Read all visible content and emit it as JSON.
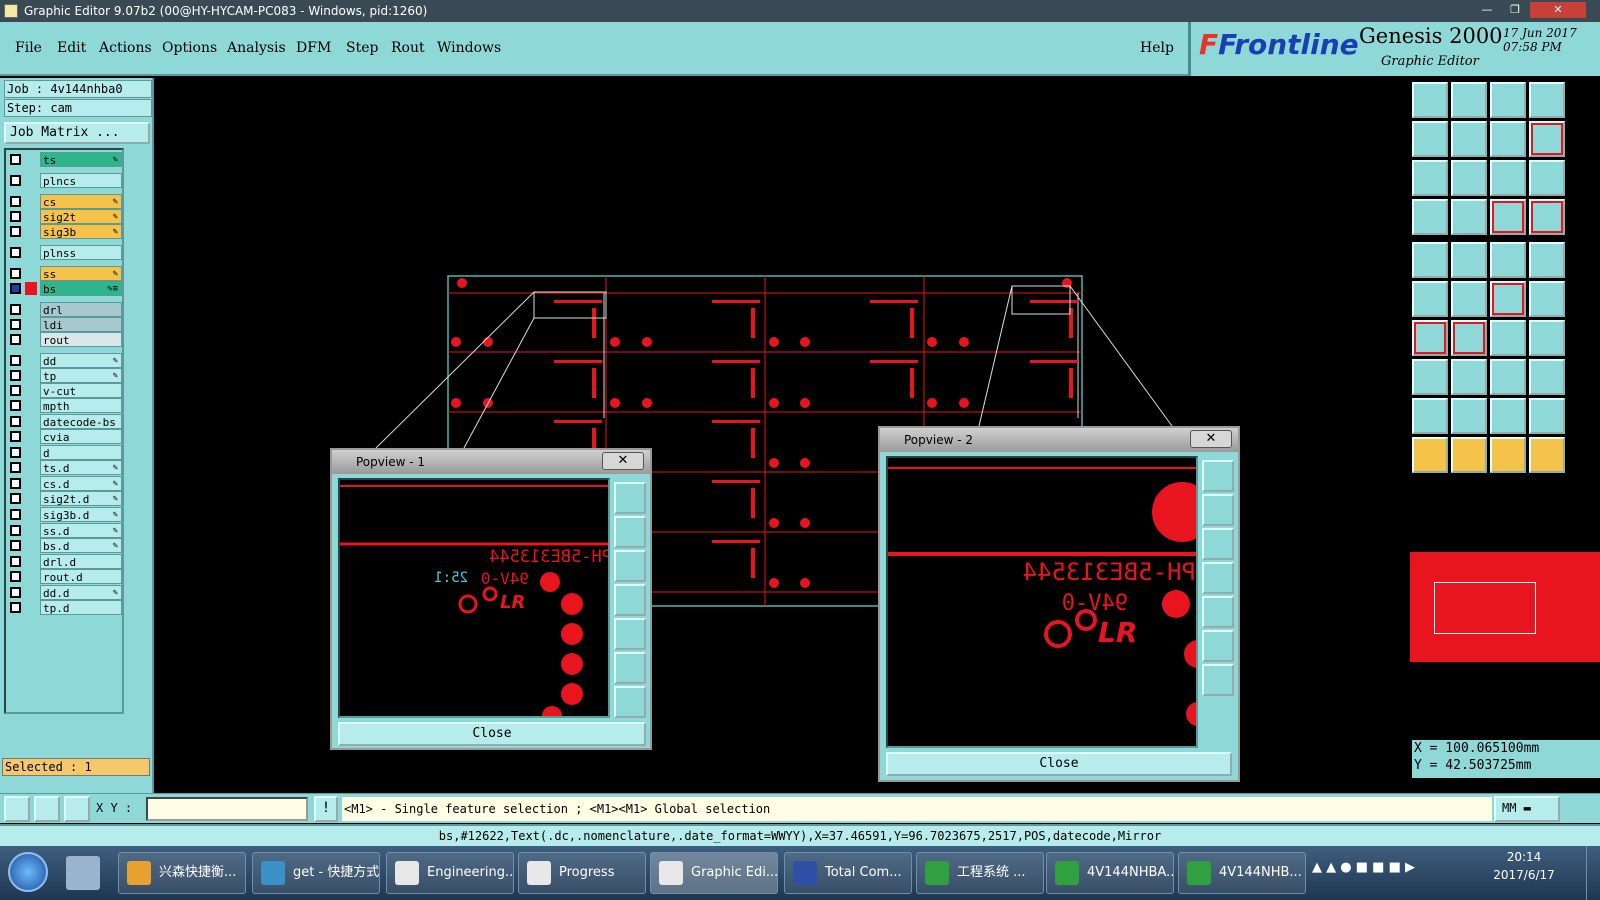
{
  "window": {
    "title": "Graphic Editor 9.07b2 (00@HY-HYCAM-PC083 - Windows, pid:1260)"
  },
  "menu": {
    "items": [
      "File",
      "Edit",
      "Actions",
      "Options",
      "Analysis",
      "DFM",
      "Step",
      "Rout",
      "Windows"
    ],
    "help": "Help"
  },
  "brand": {
    "logo_main": "Frontline",
    "logo_f": "F",
    "product": "Genesis 2000",
    "subtitle": "Graphic Editor",
    "date": "17 Jun 2017",
    "time": "07:58 PM"
  },
  "left": {
    "job": "Job : 4v144nhba0",
    "step": "Step: cam",
    "job_matrix": "Job Matrix ...",
    "selected": "Selected : 1",
    "layers": [
      {
        "name": "ts",
        "color": "#2fb58a",
        "flag": "✎"
      },
      {
        "name": "plncs",
        "color": "#b7ecec",
        "flag": ""
      },
      {
        "name": "cs",
        "color": "#f5c24a",
        "flag": "✎"
      },
      {
        "name": "sig2t",
        "color": "#f5c24a",
        "flag": "✎"
      },
      {
        "name": "sig3b",
        "color": "#f5c24a",
        "flag": "✎"
      },
      {
        "name": "plnss",
        "color": "#b7ecec",
        "flag": ""
      },
      {
        "name": "ss",
        "color": "#f5c24a",
        "flag": "✎"
      },
      {
        "name": "bs",
        "color": "#2fb58a",
        "flag": "✎≡"
      },
      {
        "name": "drl",
        "color": "#a8c8d0",
        "flag": ""
      },
      {
        "name": "ldi",
        "color": "#a8c8d0",
        "flag": ""
      },
      {
        "name": "rout",
        "color": "#d8e8e8",
        "flag": ""
      },
      {
        "name": "dd",
        "color": "#b7ecec",
        "flag": "✎"
      },
      {
        "name": "tp",
        "color": "#b7ecec",
        "flag": "✎"
      },
      {
        "name": "v-cut",
        "color": "#b7ecec",
        "flag": ""
      },
      {
        "name": "mpth",
        "color": "#b7ecec",
        "flag": ""
      },
      {
        "name": "datecode-bs",
        "color": "#b7ecec",
        "flag": ""
      },
      {
        "name": "cvia",
        "color": "#b7ecec",
        "flag": ""
      },
      {
        "name": "d",
        "color": "#b7ecec",
        "flag": ""
      },
      {
        "name": "ts.d",
        "color": "#b7ecec",
        "flag": "✎"
      },
      {
        "name": "cs.d",
        "color": "#b7ecec",
        "flag": "✎"
      },
      {
        "name": "sig2t.d",
        "color": "#b7ecec",
        "flag": "✎"
      },
      {
        "name": "sig3b.d",
        "color": "#b7ecec",
        "flag": "✎"
      },
      {
        "name": "ss.d",
        "color": "#b7ecec",
        "flag": "✎"
      },
      {
        "name": "bs.d",
        "color": "#b7ecec",
        "flag": "✎"
      },
      {
        "name": "drl.d",
        "color": "#b7ecec",
        "flag": ""
      },
      {
        "name": "rout.d",
        "color": "#b7ecec",
        "flag": ""
      },
      {
        "name": "dd.d",
        "color": "#b7ecec",
        "flag": "✎"
      },
      {
        "name": "tp.d",
        "color": "#b7ecec",
        "flag": ""
      }
    ]
  },
  "coords": {
    "x": "X = 100.065100mm",
    "y": "Y = 42.503725mm"
  },
  "cmd": {
    "xy_label": "X Y :",
    "xy_value": "",
    "hint": "<M1> - Single feature selection ; <M1><M1> Global selection",
    "units": "MM"
  },
  "status": "bs,#12622,Text(.dc,.nomenclature,.date_format=WWYY),X=37.46591,Y=96.7023675,2517,POS,datecode,Mirror",
  "popview1": {
    "title": "Popview - 1",
    "close_x": "✕",
    "close": "Close",
    "text1": "PH-5BE313544",
    "text2": "94V-0",
    "text3": "25:1",
    "logo": "LR"
  },
  "popview2": {
    "title": "Popview - 2",
    "close_x": "✕",
    "close": "Close",
    "text1": "PH-5BE313544",
    "text2": "94V-0",
    "logo": "LR"
  },
  "taskbar": {
    "tasks": [
      "兴森快捷衡...",
      "get - 快捷方式",
      "Engineering...",
      "Progress",
      "Graphic Edi...",
      "Total Com...",
      "工程系统 ...",
      "4V144NHBA...",
      "4V144NHB..."
    ],
    "clock_time": "20:14",
    "clock_date": "2017/6/17"
  },
  "colors": {
    "accent": "#8fd8d8",
    "feature": "#e8141e",
    "outline": "#4fb4b4"
  }
}
